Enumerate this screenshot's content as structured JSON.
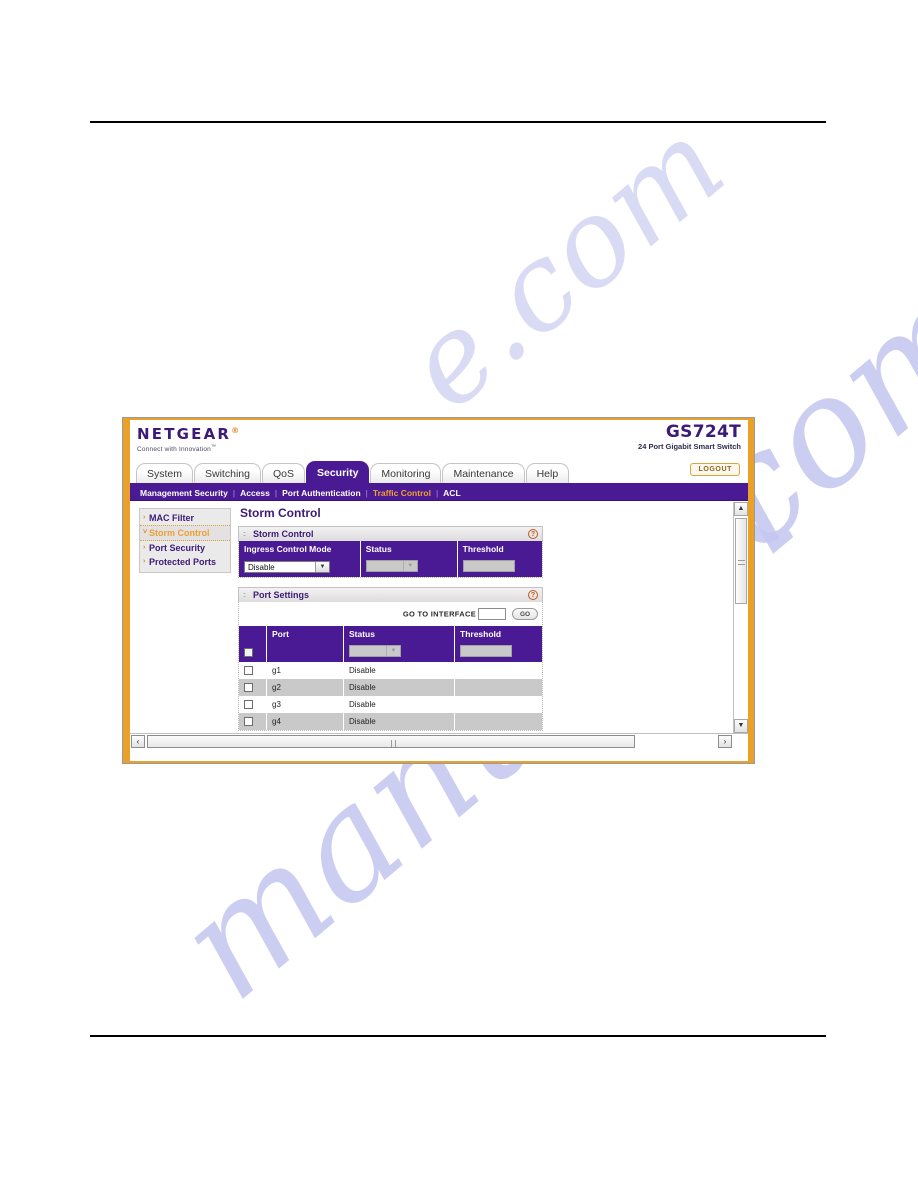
{
  "document": {
    "has_top_rule": true,
    "has_bottom_rule": true
  },
  "watermark": {
    "line_a": "manualsli",
    "line_b": "e.com",
    "line_c": "manualslib.com",
    "color": "#c3c6ef"
  },
  "browser": {
    "frame_color": "#e9a12a"
  },
  "header": {
    "logo_text": "NETGEAR",
    "logo_tm": "®",
    "tagline": "Connect with Innovation",
    "tagline_tm": "™",
    "model": "GS724T",
    "model_subtitle": "24 Port Gigabit Smart Switch",
    "logout_label": "LOGOUT"
  },
  "tabs": [
    {
      "label": "System",
      "active": false
    },
    {
      "label": "Switching",
      "active": false
    },
    {
      "label": "QoS",
      "active": false
    },
    {
      "label": "Security",
      "active": true
    },
    {
      "label": "Monitoring",
      "active": false
    },
    {
      "label": "Maintenance",
      "active": false
    },
    {
      "label": "Help",
      "active": false
    }
  ],
  "subnav": {
    "items": [
      {
        "label": "Management Security",
        "current": false
      },
      {
        "label": "Access",
        "current": false
      },
      {
        "label": "Port Authentication",
        "current": false
      },
      {
        "label": "Traffic Control",
        "current": true
      },
      {
        "label": "ACL",
        "current": false
      }
    ],
    "separator": "|",
    "current_color": "#f0a030"
  },
  "sidebar": {
    "items": [
      {
        "label": "MAC Filter",
        "selected": false,
        "arrow": "›"
      },
      {
        "label": "Storm Control",
        "selected": true,
        "arrow": "˅"
      },
      {
        "label": "Port Security",
        "selected": false,
        "arrow": "›"
      },
      {
        "label": "Protected Ports",
        "selected": false,
        "arrow": "›"
      }
    ]
  },
  "main": {
    "page_title": "Storm Control",
    "storm_control_panel": {
      "title": "Storm Control",
      "help_icon": "?",
      "headers": [
        "Ingress Control Mode",
        "Status",
        "Threshold"
      ],
      "ingress_control_mode_value": "Disable",
      "status_value": "",
      "status_disabled": true,
      "threshold_value": "",
      "threshold_disabled": true
    },
    "port_settings_panel": {
      "title": "Port Settings",
      "help_icon": "?",
      "go_to_interface_label": "GO TO INTERFACE",
      "go_to_interface_value": "",
      "go_button_label": "GO",
      "headers": [
        "",
        "Port",
        "Status",
        "Threshold"
      ],
      "filter_row": {
        "select_all_checked": true,
        "status_value": "",
        "threshold_value": ""
      },
      "rows": [
        {
          "checked": false,
          "port": "g1",
          "status": "Disable",
          "threshold": ""
        },
        {
          "checked": false,
          "port": "g2",
          "status": "Disable",
          "threshold": ""
        },
        {
          "checked": false,
          "port": "g3",
          "status": "Disable",
          "threshold": ""
        },
        {
          "checked": false,
          "port": "g4",
          "status": "Disable",
          "threshold": ""
        }
      ]
    }
  },
  "scrollbars": {
    "vertical": {
      "up_arrow": "▲",
      "down_arrow": "▼"
    },
    "horizontal": {
      "left_arrow": "‹",
      "right_arrow": "›"
    }
  }
}
